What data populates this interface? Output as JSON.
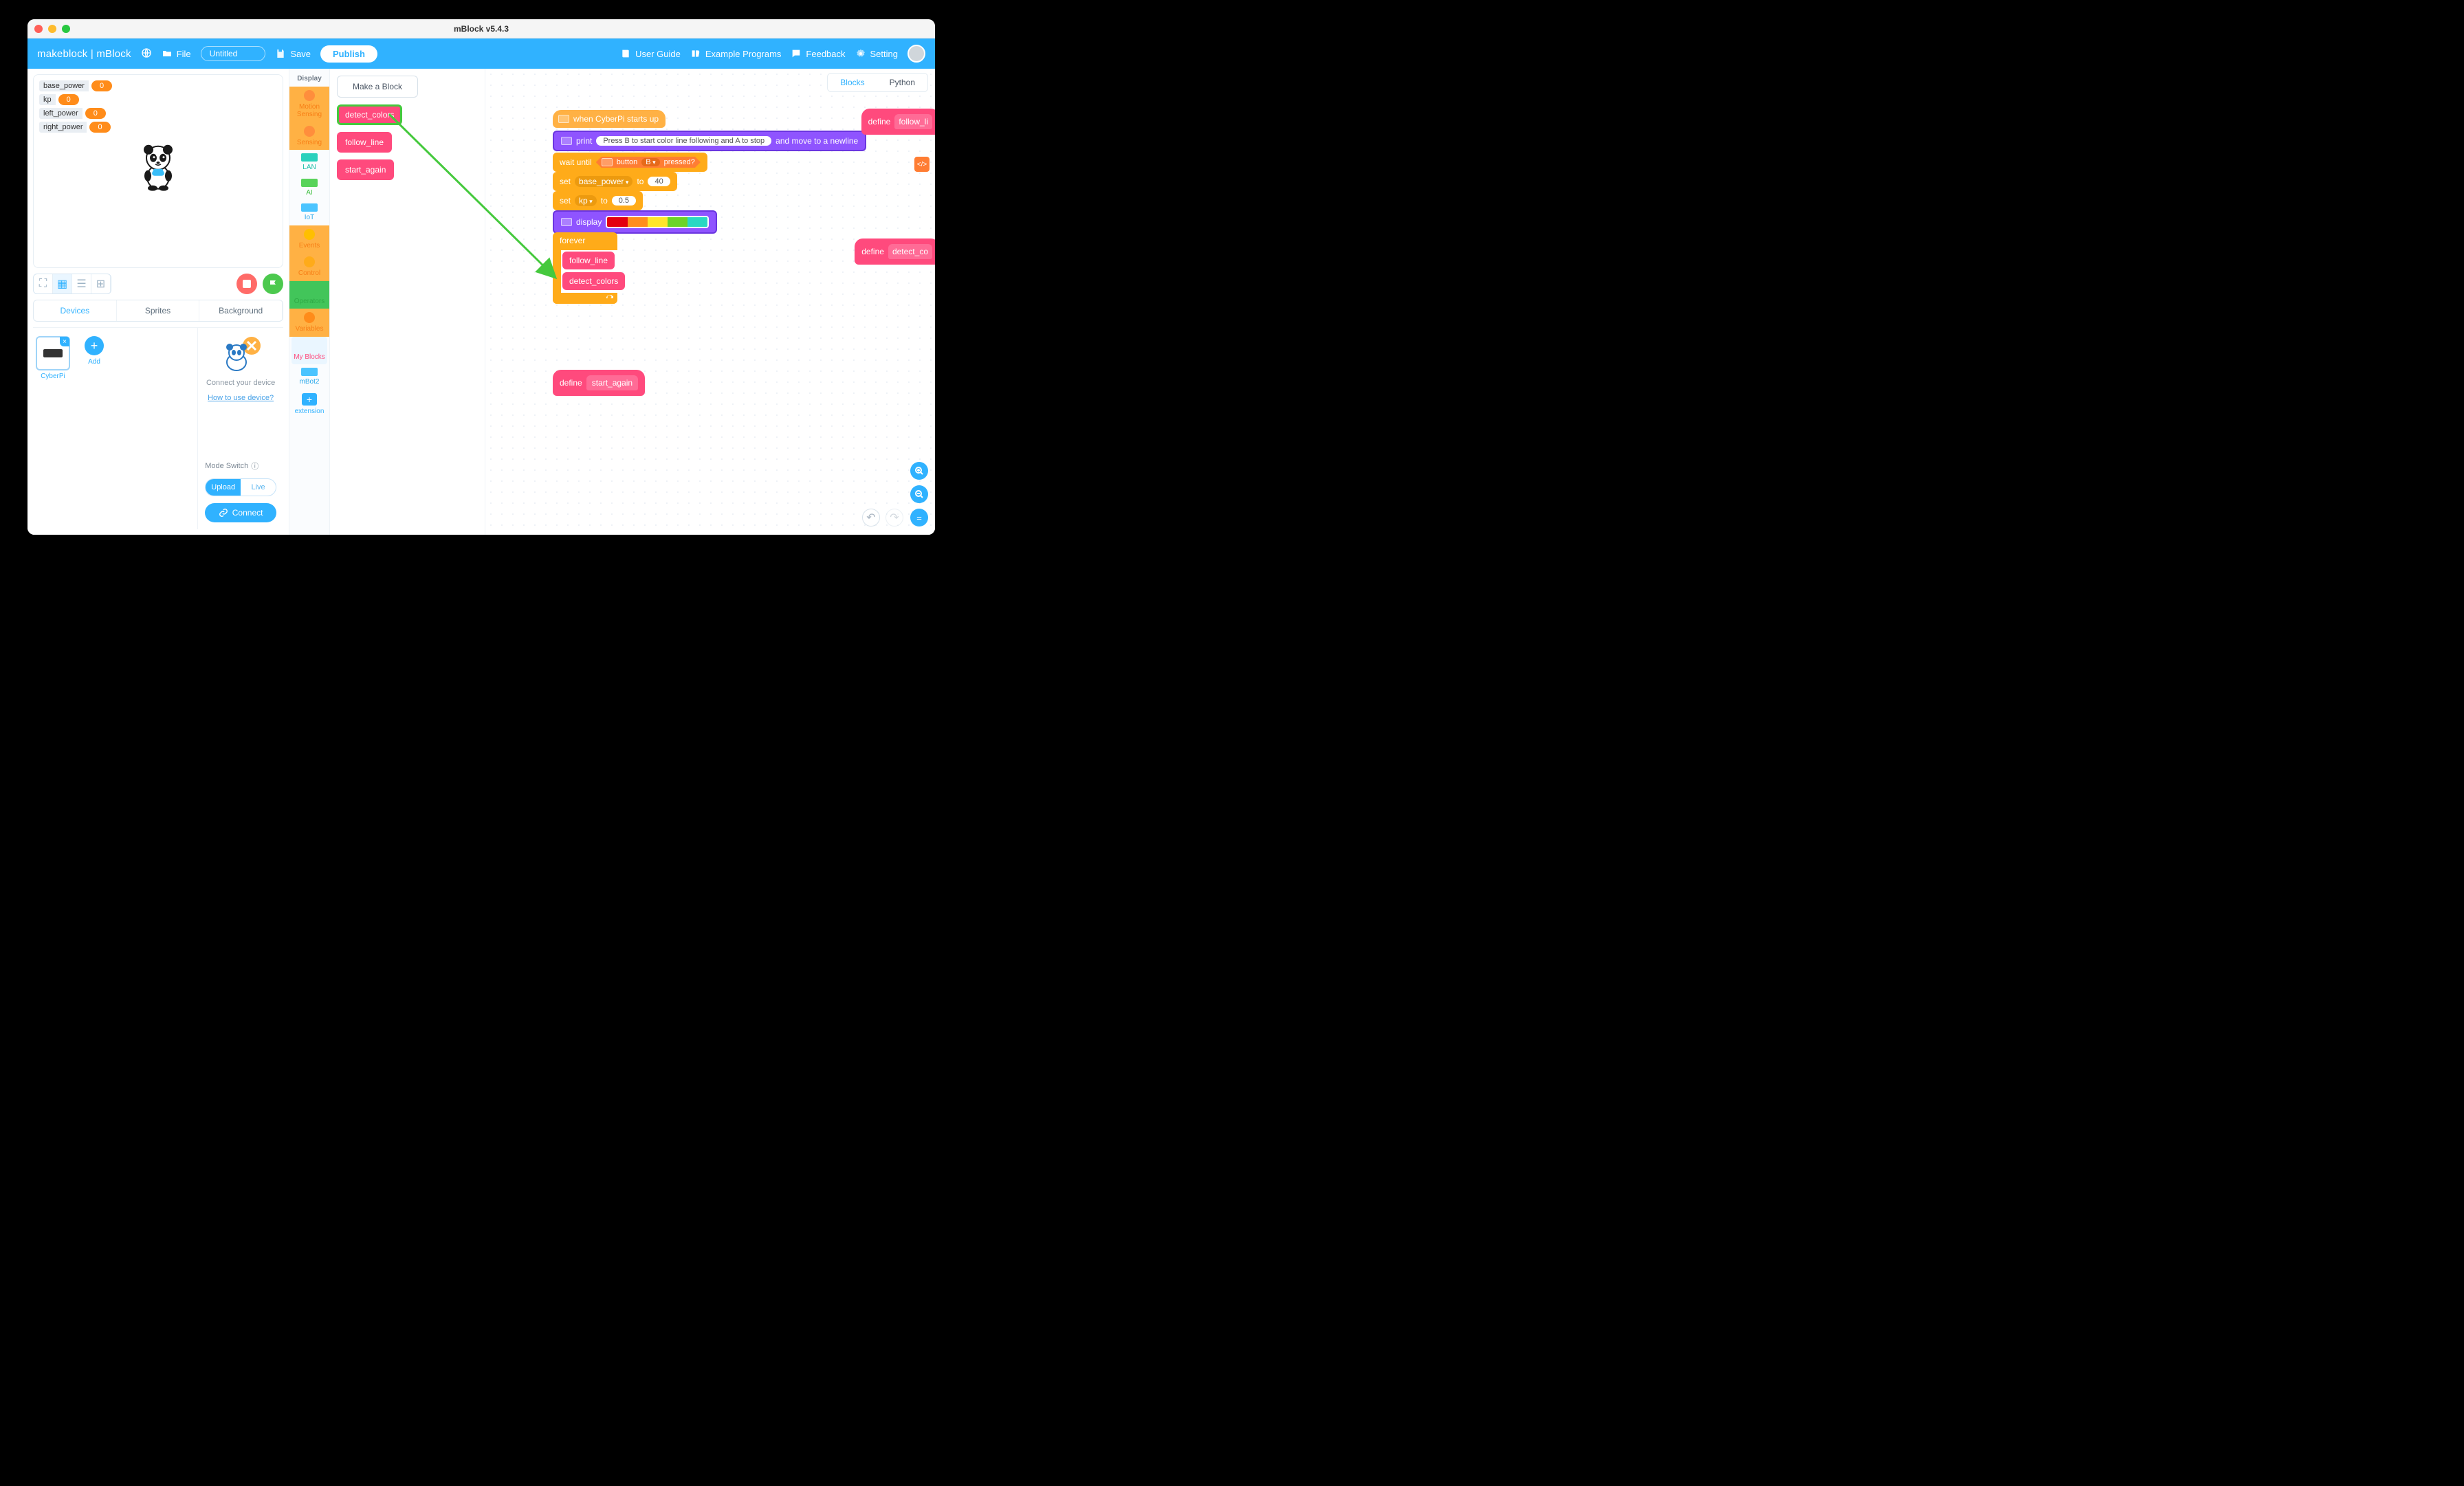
{
  "window": {
    "title": "mBlock v5.4.3"
  },
  "toolbar": {
    "brand": "makeblock | mBlock",
    "file": "File",
    "project_name": "Untitled",
    "save": "Save",
    "publish": "Publish",
    "user_guide": "User Guide",
    "example_programs": "Example Programs",
    "feedback": "Feedback",
    "setting": "Setting"
  },
  "stage_vars": [
    {
      "name": "base_power",
      "value": "0"
    },
    {
      "name": "kp",
      "value": "0"
    },
    {
      "name": "left_power",
      "value": "0"
    },
    {
      "name": "right_power",
      "value": "0"
    }
  ],
  "tabs": {
    "devices": "Devices",
    "sprites": "Sprites",
    "background": "Background"
  },
  "device": {
    "name": "CyberPi",
    "add": "Add"
  },
  "connect_panel": {
    "connect_prompt": "Connect your device",
    "howto": "How to use device?",
    "mode_switch": "Mode Switch",
    "upload": "Upload",
    "live": "Live",
    "connect": "Connect"
  },
  "categories": {
    "display": "Display",
    "motion_sensing": "Motion Sensing",
    "sensing": "Sensing",
    "lan": "LAN",
    "ai": "AI",
    "iot": "IoT",
    "events": "Events",
    "control": "Control",
    "operators": "Operators",
    "variables": "Variables",
    "my_blocks": "My Blocks",
    "mbot2": "mBot2",
    "extension": "extension"
  },
  "palette": {
    "make_block": "Make a Block",
    "blocks": [
      "detect_colors",
      "follow_line",
      "start_again"
    ]
  },
  "code_tabs": {
    "blocks": "Blocks",
    "python": "Python"
  },
  "script": {
    "hat": "when CyberPi starts up",
    "print": {
      "cmd": "print",
      "text": "Press B to start color line following and A to stop",
      "tail": "and move to a newline"
    },
    "wait": {
      "cmd": "wait until",
      "button": "button",
      "which": "B",
      "pressed": "pressed?"
    },
    "set1": {
      "cmd": "set",
      "var": "base_power",
      "to": "to",
      "val": "40"
    },
    "set2": {
      "cmd": "set",
      "var": "kp",
      "to": "to",
      "val": "0.5"
    },
    "display": "display",
    "forever": "forever",
    "follow": "follow_line",
    "detect": "detect_colors",
    "def_start": {
      "define": "define",
      "name": "start_again"
    },
    "def_follow": {
      "define": "define",
      "name": "follow_li"
    },
    "def_detect": {
      "define": "define",
      "name": "detect_co"
    }
  }
}
